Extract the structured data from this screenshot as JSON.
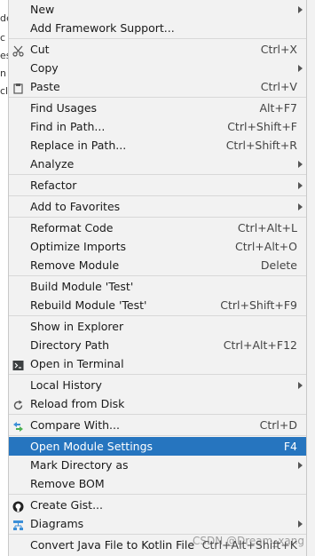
{
  "background": {
    "fragments": [
      "de",
      "c",
      "es",
      "n",
      "cl"
    ]
  },
  "menu": {
    "groups": [
      [
        {
          "label": "New",
          "shortcut": "",
          "submenu": true
        },
        {
          "label": "Add Framework Support...",
          "shortcut": "",
          "submenu": false
        }
      ],
      [
        {
          "label": "Cut",
          "shortcut": "Ctrl+X",
          "submenu": false,
          "icon": "scissors-icon"
        },
        {
          "label": "Copy",
          "shortcut": "",
          "submenu": true
        },
        {
          "label": "Paste",
          "shortcut": "Ctrl+V",
          "submenu": false,
          "icon": "clipboard-icon"
        }
      ],
      [
        {
          "label": "Find Usages",
          "shortcut": "Alt+F7",
          "submenu": false
        },
        {
          "label": "Find in Path...",
          "shortcut": "Ctrl+Shift+F",
          "submenu": false
        },
        {
          "label": "Replace in Path...",
          "shortcut": "Ctrl+Shift+R",
          "submenu": false
        },
        {
          "label": "Analyze",
          "shortcut": "",
          "submenu": true
        }
      ],
      [
        {
          "label": "Refactor",
          "shortcut": "",
          "submenu": true
        }
      ],
      [
        {
          "label": "Add to Favorites",
          "shortcut": "",
          "submenu": true
        }
      ],
      [
        {
          "label": "Reformat Code",
          "shortcut": "Ctrl+Alt+L",
          "submenu": false
        },
        {
          "label": "Optimize Imports",
          "shortcut": "Ctrl+Alt+O",
          "submenu": false
        },
        {
          "label": "Remove Module",
          "shortcut": "Delete",
          "submenu": false
        }
      ],
      [
        {
          "label": "Build Module 'Test'",
          "shortcut": "",
          "submenu": false
        },
        {
          "label": "Rebuild Module 'Test'",
          "shortcut": "Ctrl+Shift+F9",
          "submenu": false
        }
      ],
      [
        {
          "label": "Show in Explorer",
          "shortcut": "",
          "submenu": false
        },
        {
          "label": "Directory Path",
          "shortcut": "Ctrl+Alt+F12",
          "submenu": false
        },
        {
          "label": "Open in Terminal",
          "shortcut": "",
          "submenu": false,
          "icon": "terminal-icon"
        }
      ],
      [
        {
          "label": "Local History",
          "shortcut": "",
          "submenu": true
        },
        {
          "label": "Reload from Disk",
          "shortcut": "",
          "submenu": false,
          "icon": "reload-icon"
        }
      ],
      [
        {
          "label": "Compare With...",
          "shortcut": "Ctrl+D",
          "submenu": false,
          "icon": "compare-icon"
        }
      ],
      [
        {
          "label": "Open Module Settings",
          "shortcut": "F4",
          "submenu": false,
          "selected": true
        },
        {
          "label": "Mark Directory as",
          "shortcut": "",
          "submenu": true
        },
        {
          "label": "Remove BOM",
          "shortcut": "",
          "submenu": false
        }
      ],
      [
        {
          "label": "Create Gist...",
          "shortcut": "",
          "submenu": false,
          "icon": "github-icon"
        },
        {
          "label": "Diagrams",
          "shortcut": "",
          "submenu": true,
          "icon": "diagram-icon"
        }
      ],
      [
        {
          "label": "Convert Java File to Kotlin File",
          "shortcut": "Ctrl+Alt+Shift+K",
          "submenu": false
        }
      ]
    ]
  },
  "watermark": "CSDN @Dream_xang",
  "colors": {
    "selection": "#2675bf",
    "menu_bg": "#f2f2f2",
    "separator": "#d8d8d8"
  }
}
